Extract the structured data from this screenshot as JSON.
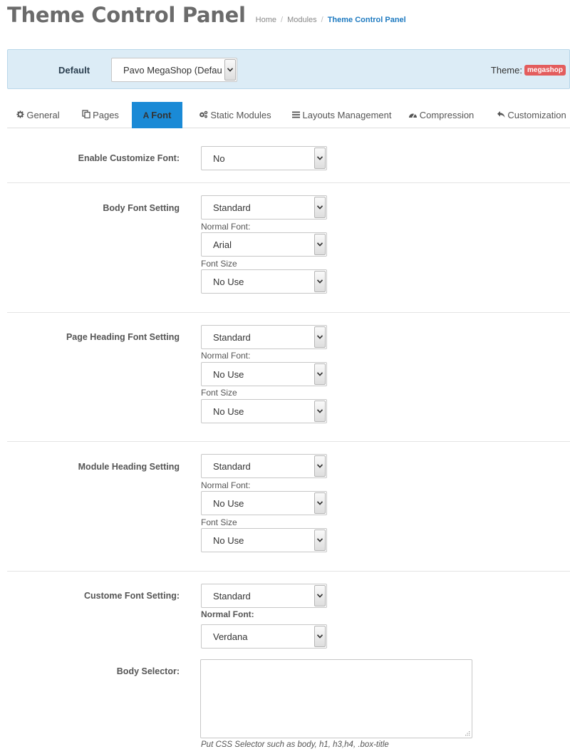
{
  "header": {
    "title": "Theme Control Panel",
    "breadcrumb": [
      "Home",
      "Modules",
      "Theme Control Panel"
    ]
  },
  "profile": {
    "label": "Default",
    "selected": "Pavo MegaShop (Defau",
    "theme_label": "Theme:",
    "theme_badge": "megashop"
  },
  "tabs": [
    {
      "label": "General",
      "icon": "gear-icon"
    },
    {
      "label": "Pages",
      "icon": "copy-icon"
    },
    {
      "label": "Font",
      "icon": "font-icon",
      "active": true
    },
    {
      "label": "Static Modules",
      "icon": "cogs-icon"
    },
    {
      "label": "Layouts Management",
      "icon": "bars-icon"
    },
    {
      "label": "Compression",
      "icon": "dashboard-icon"
    },
    {
      "label": "Customization",
      "icon": "reply-icon"
    }
  ],
  "form": {
    "enable": {
      "label": "Enable Customize Font:",
      "value": "No"
    },
    "body": {
      "label": "Body Font Setting",
      "type_value": "Standard",
      "normal_label": "Normal Font:",
      "normal_value": "Arial",
      "size_label": "Font Size",
      "size_value": "No Use"
    },
    "page_heading": {
      "label": "Page Heading Font Setting",
      "type_value": "Standard",
      "normal_label": "Normal Font:",
      "normal_value": "No Use",
      "size_label": "Font Size",
      "size_value": "No Use"
    },
    "module_heading": {
      "label": "Module Heading Setting",
      "type_value": "Standard",
      "normal_label": "Normal Font:",
      "normal_value": "No Use",
      "size_label": "Font Size",
      "size_value": "No Use"
    },
    "custom": {
      "label": "Custome Font Setting:",
      "type_value": "Standard",
      "normal_label": "Normal Font:",
      "normal_value": "Verdana"
    },
    "selector": {
      "label": "Body Selector:",
      "value": "",
      "help": "Put CSS Selector such as body, h1, h3,h4, .box-title"
    }
  },
  "colors": {
    "accent": "#1a8ad6",
    "profile_bg": "#dcecf6",
    "badge": "#e35d5d",
    "title": "#6b6b6b",
    "link_active": "#1e7ac0"
  }
}
